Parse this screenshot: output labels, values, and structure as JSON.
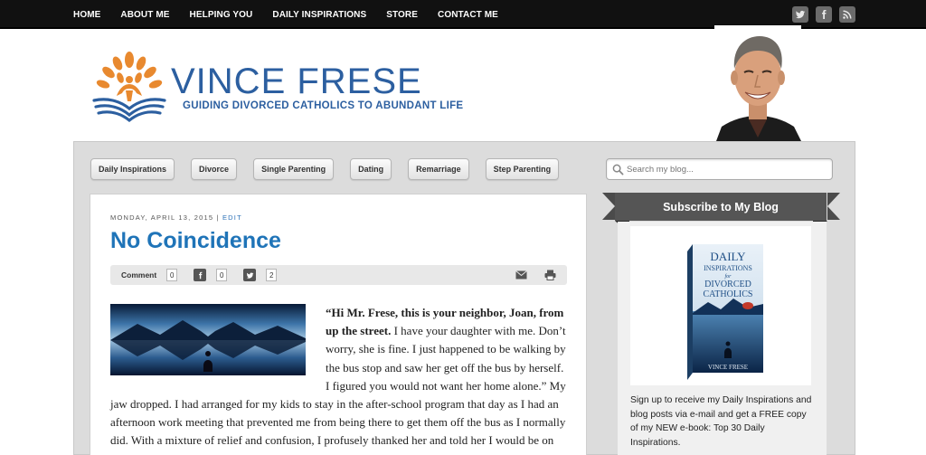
{
  "nav": {
    "items": [
      "HOME",
      "ABOUT ME",
      "HELPING YOU",
      "DAILY INSPIRATIONS",
      "STORE",
      "CONTACT ME"
    ],
    "social": [
      "twitter-icon",
      "facebook-icon",
      "rss-icon"
    ]
  },
  "header": {
    "title": "VINCE FRESE",
    "tagline": "GUIDING DIVORCED CATHOLICS TO ABUNDANT LIFE"
  },
  "categories": [
    "Daily Inspirations",
    "Divorce",
    "Single Parenting",
    "Dating",
    "Remarriage",
    "Step Parenting"
  ],
  "search": {
    "placeholder": "Search my blog..."
  },
  "post": {
    "date": "MONDAY, APRIL 13, 2015",
    "separator": "|",
    "edit": "EDIT",
    "title": "No Coincidence",
    "comment_label": "Comment",
    "comment_count": "0",
    "facebook_count": "0",
    "twitter_count": "2",
    "lead_bold": "“Hi Mr. Frese, this is your neighbor, Joan, from up the street.",
    "body": " I have your daughter with me. Don’t worry, she is fine. I just happened to be walking by the bus stop and saw her get off the bus by herself. I figured you would not want her home alone.” My jaw dropped. I had arranged for my kids to stay in the after-school program that day as I had an afternoon work meeting that prevented me from being there to get them off the bus as I normally did. With a mixture of relief and confusion, I profusely thanked her and told her I would be on my way to pick up my daughter."
  },
  "sidebar": {
    "subscribe_title": "Subscribe to My Blog",
    "book": {
      "line1": "DAILY",
      "line2": "INSPIRATIONS",
      "line3": "for",
      "line4": "DIVORCED",
      "line5": "CATHOLICS",
      "author": "VINCE FRESE"
    },
    "subscribe_text": "Sign up to receive my Daily Inspirations and blog posts via e-mail and get a FREE copy of my NEW e-book: Top 30 Daily Inspirations."
  },
  "colors": {
    "brand_blue": "#2c5fa0",
    "title_blue": "#1f74b8",
    "logo_orange": "#e8892f",
    "nav_bg": "#111111"
  }
}
